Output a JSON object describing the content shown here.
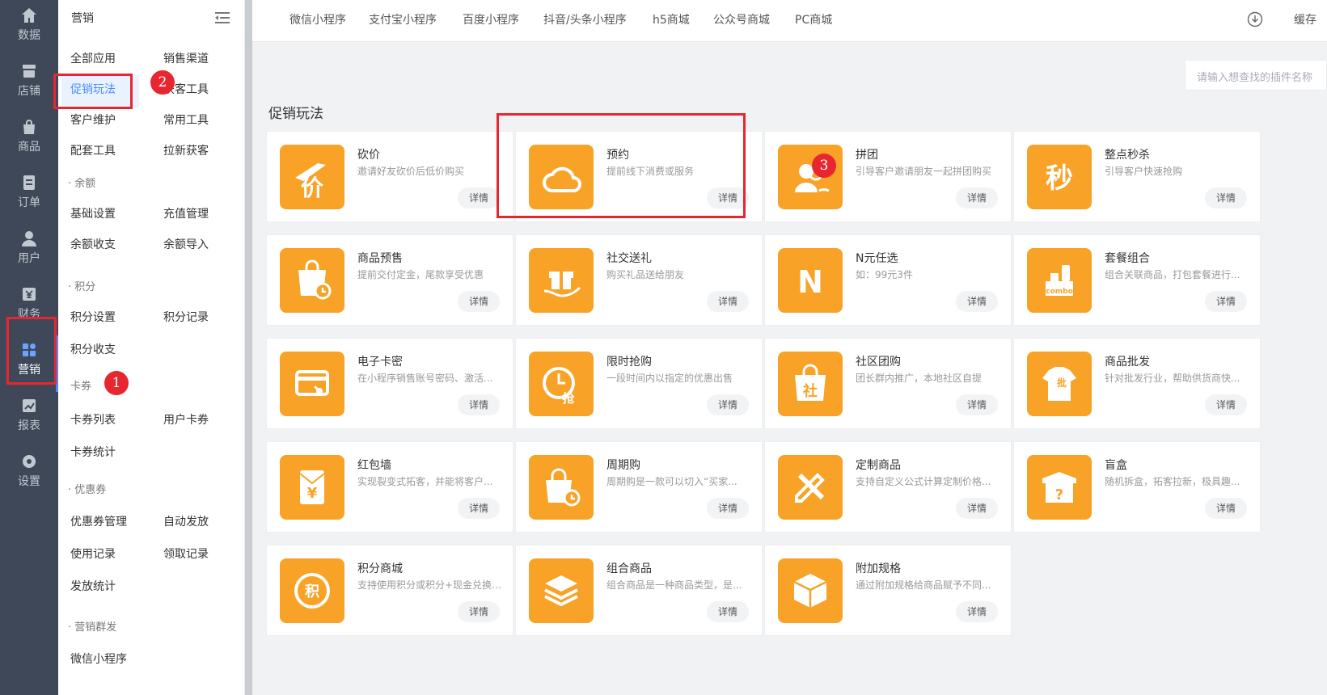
{
  "rail": {
    "items": [
      {
        "label": "数据",
        "icon": "home-icon"
      },
      {
        "label": "店铺",
        "icon": "store-icon"
      },
      {
        "label": "商品",
        "icon": "bag-icon"
      },
      {
        "label": "订单",
        "icon": "order-icon"
      },
      {
        "label": "用户",
        "icon": "user-icon"
      },
      {
        "label": "财务",
        "icon": "finance-icon"
      },
      {
        "label": "营销",
        "icon": "marketing-icon"
      },
      {
        "label": "报表",
        "icon": "chart-icon"
      },
      {
        "label": "设置",
        "icon": "gear-icon"
      }
    ],
    "active": "营销"
  },
  "menu": {
    "title": "营销",
    "items": [
      "全部应用",
      "销售渠道",
      "促销玩法",
      "获客工具",
      "客户维护",
      "常用工具",
      "配套工具",
      "拉新获客",
      "· 余额",
      "基础设置",
      "充值管理",
      "余额收支",
      "余额导入",
      "· 积分",
      "积分设置",
      "积分记录",
      "积分收支",
      "卡券",
      "卡券列表",
      "用户卡券",
      "卡券统计",
      "· 优惠券",
      "优惠券管理",
      "自动发放",
      "使用记录",
      "领取记录",
      "发放统计",
      "· 营销群发",
      "微信小程序"
    ],
    "active": "促销玩法"
  },
  "topbar": {
    "tabs": [
      "微信小程序",
      "支付宝小程序",
      "百度小程序",
      "抖音/头条小程序",
      "h5商城",
      "公众号商城",
      "PC商城"
    ],
    "cache_label": "缓存"
  },
  "search": {
    "placeholder": "请输入想查找的插件名称"
  },
  "section_title": "促销玩法",
  "detail_label": "详情",
  "cards": [
    {
      "name": "砍价",
      "desc": "邀请好友砍价后低价购买",
      "icon": "price-icon"
    },
    {
      "name": "预约",
      "desc": "提前线下消费或服务",
      "icon": "cloud-icon"
    },
    {
      "name": "拼团",
      "desc": "引导客户邀请朋友一起拼团购买",
      "icon": "group-icon"
    },
    {
      "name": "整点秒杀",
      "desc": "引导客户快速抢购",
      "icon": "seckill-icon",
      "glyph": "秒"
    },
    {
      "name": "商品预售",
      "desc": "提前交付定金，尾款享受优惠",
      "icon": "presale-bag-icon"
    },
    {
      "name": "社交送礼",
      "desc": "购买礼品送给朋友",
      "icon": "gift-icon"
    },
    {
      "name": "N元任选",
      "desc": "如：99元3件",
      "icon": "n-letter-icon",
      "glyph": "N"
    },
    {
      "name": "套餐组合",
      "desc": "组合关联商品，打包套餐进行...",
      "icon": "combo-icon",
      "glyph": "combo"
    },
    {
      "name": "电子卡密",
      "desc": "在小程序销售账号密码、激活...",
      "icon": "card-key-icon"
    },
    {
      "name": "限时抢购",
      "desc": "一段时间内以指定的优惠出售",
      "icon": "clock-icon",
      "glyph": "抢"
    },
    {
      "name": "社区团购",
      "desc": "团长群内推广，本地社区自提",
      "icon": "community-bag-icon",
      "glyph": "社"
    },
    {
      "name": "商品批发",
      "desc": "针对批发行业，帮助供货商快...",
      "icon": "wholesale-shirt-icon",
      "glyph": "批"
    },
    {
      "name": "红包墙",
      "desc": "实现裂变式拓客，并能将客户...",
      "icon": "red-packet-icon",
      "glyph": "¥"
    },
    {
      "name": "周期购",
      "desc": "周期购是一款可以切入“买家...",
      "icon": "periodic-bag-icon"
    },
    {
      "name": "定制商品",
      "desc": "支持自定义公式计算定制价格...",
      "icon": "pencil-ruler-icon"
    },
    {
      "name": "盲盒",
      "desc": "随机拆盒，拓客拉新，极具趣...",
      "icon": "blind-box-icon",
      "glyph": "?"
    },
    {
      "name": "积分商城",
      "desc": "支持使用积分或积分+现金兑换商品",
      "icon": "points-icon",
      "glyph": "积"
    },
    {
      "name": "组合商品",
      "desc": "组合商品是一种商品类型，是...",
      "icon": "layers-icon"
    },
    {
      "name": "附加规格",
      "desc": "通过附加规格给商品赋予不同...",
      "icon": "box-icon"
    }
  ],
  "annotations": [
    "1",
    "2",
    "3"
  ],
  "colors": {
    "accent": "#4a8cff",
    "icon_bg": "#f8a227",
    "highlight": "#e8262f",
    "rail_bg": "#3e4858"
  }
}
